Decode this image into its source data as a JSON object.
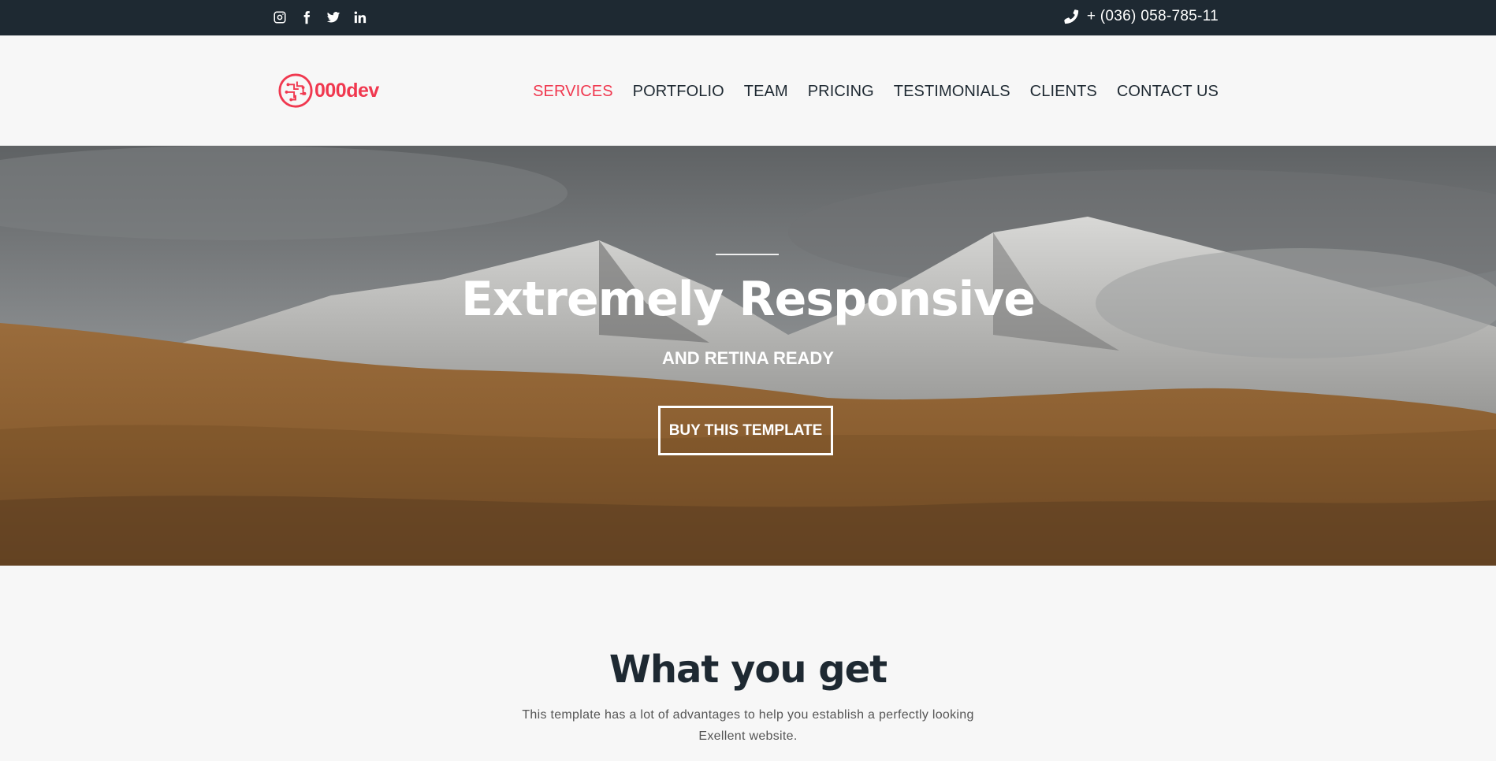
{
  "topbar": {
    "social": [
      {
        "icon": "instagram-icon"
      },
      {
        "icon": "facebook-icon"
      },
      {
        "icon": "twitter-icon"
      },
      {
        "icon": "linkedin-icon"
      }
    ],
    "phone": "+ (036) 058-785-11",
    "phone_icon": "phone-icon"
  },
  "header": {
    "logo_text": "000dev",
    "nav": [
      {
        "label": "SERVICES",
        "active": true
      },
      {
        "label": "PORTFOLIO"
      },
      {
        "label": "TEAM"
      },
      {
        "label": "PRICING"
      },
      {
        "label": "TESTIMONIALS"
      },
      {
        "label": "CLIENTS"
      },
      {
        "label": "CONTACT US"
      }
    ]
  },
  "hero": {
    "title": "Extremely Responsive",
    "subtitle": "AND RETINA READY",
    "button_label": "BUY THIS TEMPLATE"
  },
  "features": {
    "title": "What you get",
    "text": "This template has a lot of advantages to help you establish a perfectly looking Exellent website."
  },
  "colors": {
    "accent": "#f0384f",
    "dark": "#1e2932",
    "background": "#f7f7f7"
  }
}
